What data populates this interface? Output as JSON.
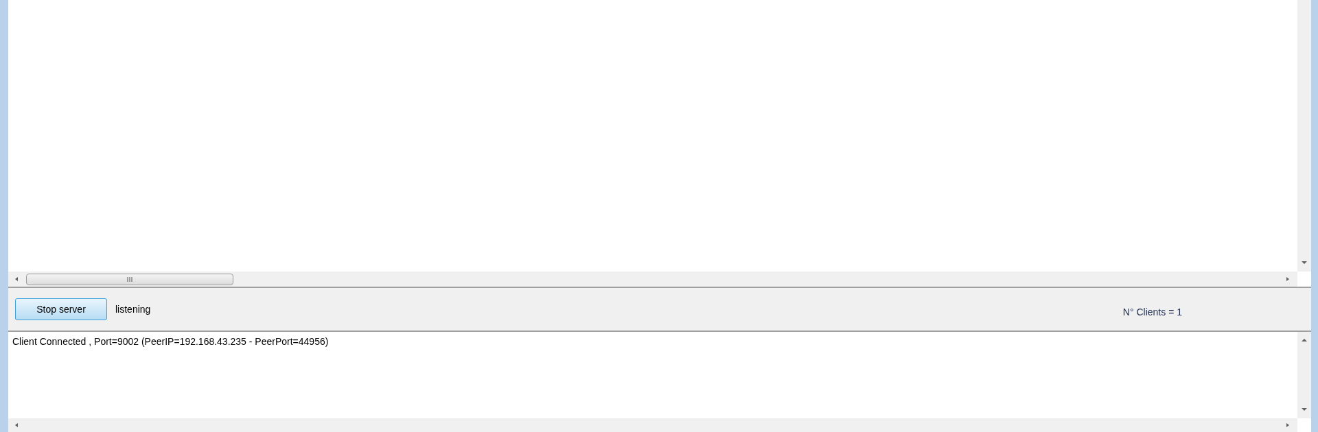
{
  "controls": {
    "button": "Stop server",
    "status": "listening",
    "clients": "N° Clients = 1"
  },
  "log": {
    "lines": [
      "Client Connected , Port=9002 (PeerIP=192.168.43.235 - PeerPort=44956)"
    ]
  }
}
